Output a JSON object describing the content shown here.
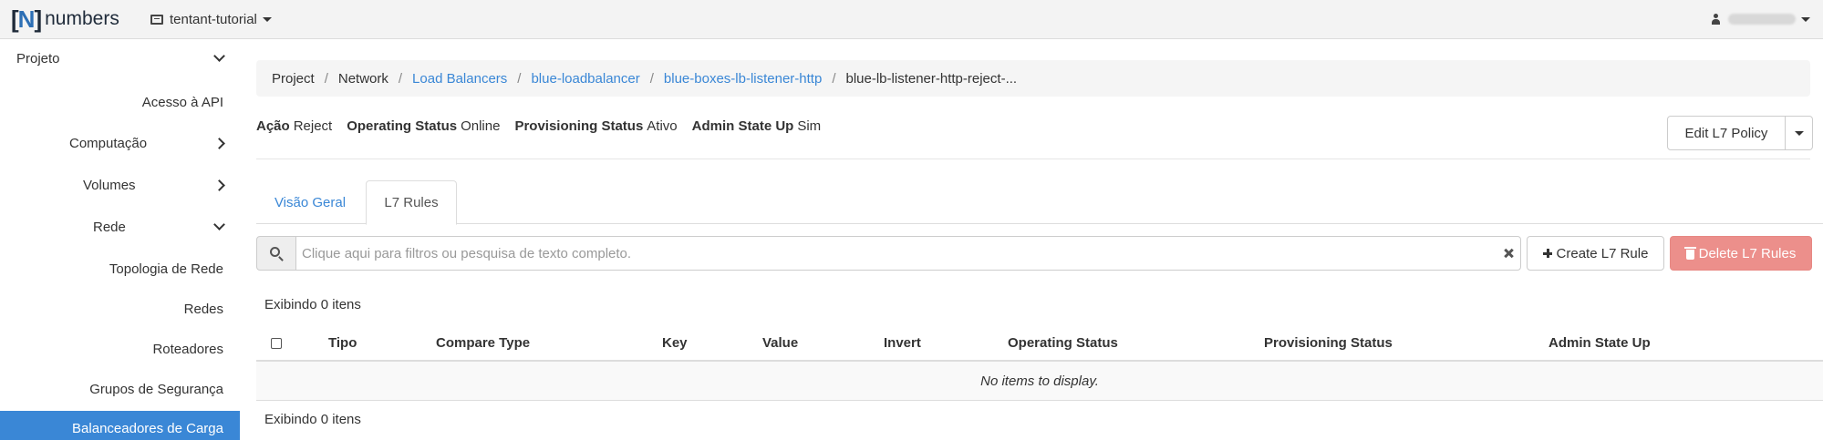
{
  "brand": {
    "bracket_left": "[",
    "letter": "N",
    "bracket_right": "]",
    "word": "numbers"
  },
  "project": {
    "name": "tentant-tutorial"
  },
  "user": {
    "icon": "user-icon"
  },
  "sidebar": {
    "items": [
      {
        "label": "Projeto",
        "chevron": "down"
      },
      {
        "label": "Acesso à API"
      },
      {
        "label": "Computação",
        "chevron": "right"
      },
      {
        "label": "Volumes",
        "chevron": "right"
      },
      {
        "label": "Rede",
        "chevron": "down"
      },
      {
        "label": "Topologia de Rede"
      },
      {
        "label": "Redes"
      },
      {
        "label": "Roteadores"
      },
      {
        "label": "Grupos de Segurança"
      },
      {
        "label": "Balanceadores de Carga",
        "active": true
      }
    ]
  },
  "breadcrumb": {
    "items": [
      {
        "label": "Project",
        "link": false
      },
      {
        "label": "Network",
        "link": false
      },
      {
        "label": "Load Balancers",
        "link": true
      },
      {
        "label": "blue-loadbalancer",
        "link": true
      },
      {
        "label": "blue-boxes-lb-listener-http",
        "link": true
      },
      {
        "label": "blue-lb-listener-http-reject-...",
        "link": false
      }
    ],
    "separator": "/"
  },
  "detail": {
    "action_key": "Ação",
    "action_value": "Reject",
    "operating_key": "Operating Status",
    "operating_value": "Online",
    "provisioning_key": "Provisioning Status",
    "provisioning_value": "Ativo",
    "admin_key": "Admin State Up",
    "admin_value": "Sim"
  },
  "actions": {
    "edit_policy": "Edit L7 Policy"
  },
  "tabs": [
    {
      "label": "Visão Geral",
      "active": false
    },
    {
      "label": "L7 Rules",
      "active": true
    }
  ],
  "search": {
    "placeholder": "Clique aqui para filtros ou pesquisa de texto completo.",
    "value": ""
  },
  "table_actions": {
    "create": "Create L7 Rule",
    "delete": "Delete L7 Rules"
  },
  "table": {
    "count_label": "Exibindo 0 itens",
    "columns": [
      "Tipo",
      "Compare Type",
      "Key",
      "Value",
      "Invert",
      "Operating Status",
      "Provisioning Status",
      "Admin State Up"
    ],
    "empty_message": "No items to display.",
    "rows": []
  },
  "colors": {
    "accent": "#3a87d6",
    "danger": "#ec8a85",
    "navbar": "#f3f3f3"
  }
}
